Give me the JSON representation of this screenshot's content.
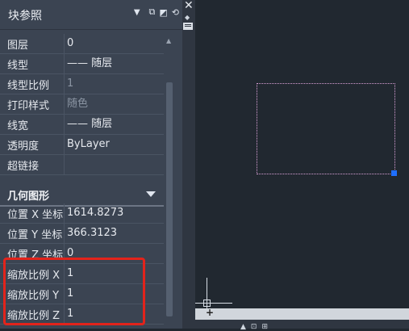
{
  "panel": {
    "title": "块参照",
    "header_icons": [
      "dropdown-arrow-icon",
      "quick-select-icon",
      "select-objects-icon",
      "toggle-pickadd-icon"
    ],
    "properties": [
      {
        "label": "图层",
        "value": "0",
        "dim": false
      },
      {
        "label": "线型",
        "value": "—— 随层",
        "dim": false
      },
      {
        "label": "线型比例",
        "value": "1",
        "dim": true
      },
      {
        "label": "打印样式",
        "value": "随色",
        "dim": true
      },
      {
        "label": "线宽",
        "value": "—— 随层",
        "dim": false
      },
      {
        "label": "透明度",
        "value": "ByLayer",
        "dim": false
      },
      {
        "label": "超链接",
        "value": "",
        "dim": false
      }
    ],
    "geometry_section": {
      "title": "几何图形",
      "properties": [
        {
          "label": "位置 X 坐标",
          "value": "1614.8273"
        },
        {
          "label": "位置 Y 坐标",
          "value": "366.3123"
        },
        {
          "label": "位置 Z 坐标",
          "value": "0"
        },
        {
          "label": "缩放比例 X",
          "value": "1"
        },
        {
          "label": "缩放比例 Y",
          "value": "1"
        },
        {
          "label": "缩放比例 Z",
          "value": "1"
        }
      ]
    }
  },
  "canvas": {
    "background": "#212830",
    "selection_border_color": "#d9a0d6",
    "grip_color": "#1f6fff"
  },
  "tabbar": {
    "add_tab": "+"
  },
  "highlight_color": "#e3231b"
}
